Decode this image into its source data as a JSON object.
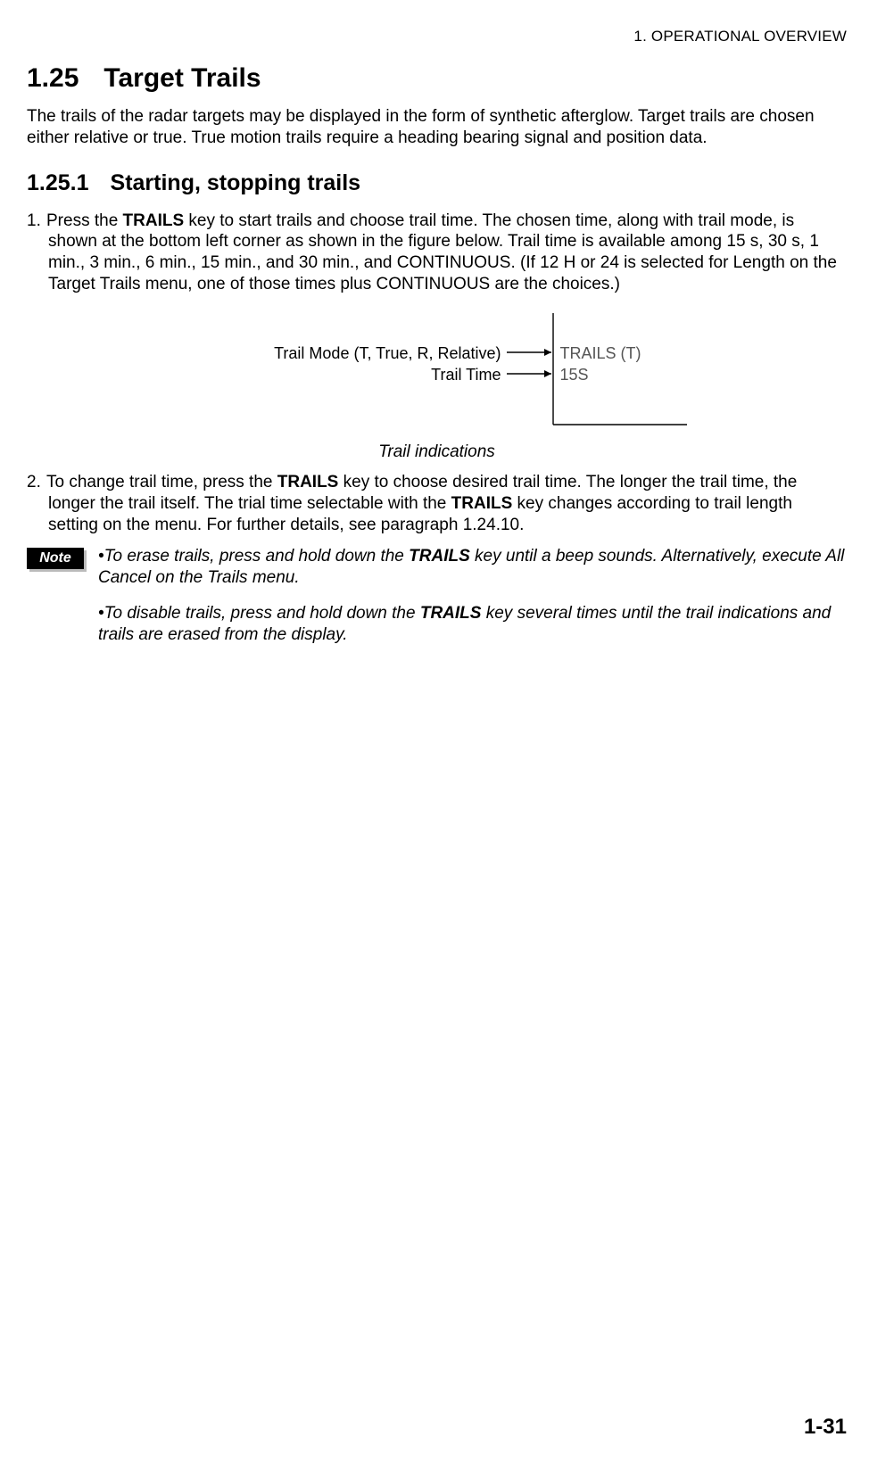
{
  "header": {
    "chapter": "1. OPERATIONAL OVERVIEW"
  },
  "section": {
    "number": "1.25",
    "title": "Target Trails"
  },
  "intro": "The trails of the radar targets may be displayed in the form of synthetic afterglow. Target trails are chosen either relative or true. True motion trails require a heading bearing signal and position data.",
  "subsection": {
    "number": "1.25.1",
    "title": "Starting, stopping trails"
  },
  "steps": {
    "s1_a": "Press the ",
    "s1_key": "TRAILS",
    "s1_b": " key to start trails and choose trail time. The chosen time, along with trail mode, is shown at the bottom left corner as shown in the figure below. Trail time is available among 15 s, 30 s, 1 min., 3 min., 6 min., 15 min., and 30 min., and CONTINUOUS. (If 12 H or 24 is selected for Length on the Target Trails menu, one of those times plus CONTINUOUS are the choices.)",
    "s2_a": "To change trail time, press the ",
    "s2_key1": "TRAILS",
    "s2_b": " key to choose desired trail time. The longer the trail time, the longer the trail itself. The trial time selectable with the ",
    "s2_key2": "TRAILS",
    "s2_c": " key changes according to trail length setting on the menu. For further details, see paragraph 1.24.10."
  },
  "figure": {
    "label_mode": "Trail Mode (T, True, R, Relative)",
    "label_time": "Trail Time",
    "display_line1": "TRAILS (T)",
    "display_line2": "15S",
    "caption": "Trail indications"
  },
  "note": {
    "badge": "Note",
    "p1_a": "•To erase trails, press and hold down the ",
    "p1_key": "TRAILS",
    "p1_b": " key until a beep sounds. Alternatively, execute All Cancel on the Trails menu.",
    "p2_a": "•To disable trails, press and hold down the ",
    "p2_key": "TRAILS",
    "p2_b": " key several times until the trail indications and trails are erased from the display."
  },
  "page_number": "1-31"
}
